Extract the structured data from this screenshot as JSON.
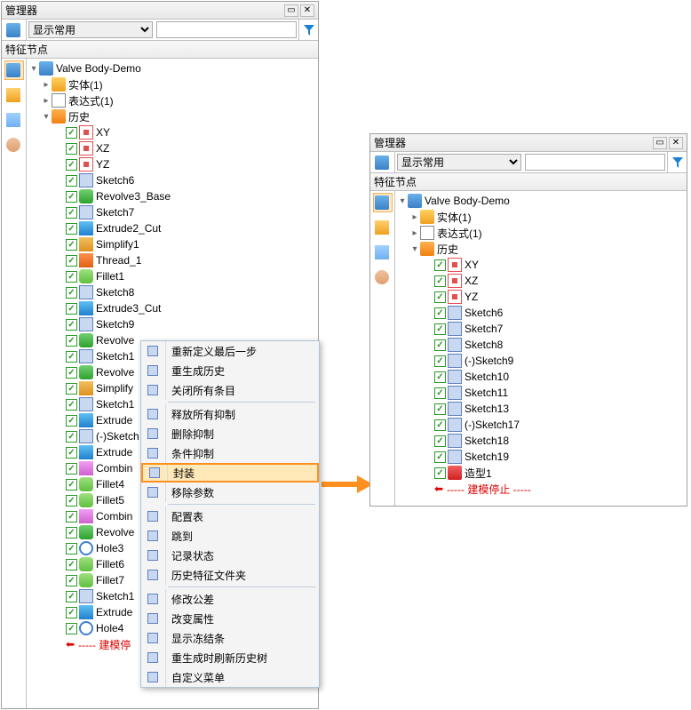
{
  "panels": {
    "left": {
      "title": "管理器",
      "dropdown": "显示常用",
      "search": "",
      "subheader": "特征节点",
      "root": "Valve Body-Demo",
      "top_nodes": {
        "solids": "实体(1)",
        "expr": "表达式(1)",
        "history": "历史"
      },
      "items": [
        {
          "ic": "ic-plane",
          "lbl": "XY"
        },
        {
          "ic": "ic-plane",
          "lbl": "XZ"
        },
        {
          "ic": "ic-plane",
          "lbl": "YZ"
        },
        {
          "ic": "ic-sketch",
          "lbl": "Sketch6"
        },
        {
          "ic": "ic-revolve",
          "lbl": "Revolve3_Base"
        },
        {
          "ic": "ic-sketch",
          "lbl": "Sketch7"
        },
        {
          "ic": "ic-extrude",
          "lbl": "Extrude2_Cut"
        },
        {
          "ic": "ic-simplify",
          "lbl": "Simplify1"
        },
        {
          "ic": "ic-thread",
          "lbl": "Thread_1"
        },
        {
          "ic": "ic-fillet",
          "lbl": "Fillet1"
        },
        {
          "ic": "ic-sketch",
          "lbl": "Sketch8"
        },
        {
          "ic": "ic-extrude",
          "lbl": "Extrude3_Cut"
        },
        {
          "ic": "ic-sketch",
          "lbl": "Sketch9"
        },
        {
          "ic": "ic-revolve",
          "lbl": "Revolve"
        },
        {
          "ic": "ic-sketch",
          "lbl": "Sketch1"
        },
        {
          "ic": "ic-revolve",
          "lbl": "Revolve"
        },
        {
          "ic": "ic-simplify",
          "lbl": "Simplify"
        },
        {
          "ic": "ic-sketch",
          "lbl": "Sketch1"
        },
        {
          "ic": "ic-extrude",
          "lbl": "Extrude"
        },
        {
          "ic": "ic-sketch",
          "lbl": "(-)Sketch"
        },
        {
          "ic": "ic-extrude",
          "lbl": "Extrude"
        },
        {
          "ic": "ic-combine",
          "lbl": "Combin"
        },
        {
          "ic": "ic-fillet",
          "lbl": "Fillet4"
        },
        {
          "ic": "ic-fillet",
          "lbl": "Fillet5"
        },
        {
          "ic": "ic-combine",
          "lbl": "Combin"
        },
        {
          "ic": "ic-revolve",
          "lbl": "Revolve"
        },
        {
          "ic": "ic-hole",
          "lbl": "Hole3"
        },
        {
          "ic": "ic-fillet",
          "lbl": "Fillet6"
        },
        {
          "ic": "ic-fillet",
          "lbl": "Fillet7"
        },
        {
          "ic": "ic-sketch",
          "lbl": "Sketch1"
        },
        {
          "ic": "ic-extrude",
          "lbl": "Extrude"
        },
        {
          "ic": "ic-hole",
          "lbl": "Hole4"
        }
      ],
      "stop": "----- 建模停"
    },
    "right": {
      "title": "管理器",
      "dropdown": "显示常用",
      "subheader": "特征节点",
      "root": "Valve Body-Demo",
      "top_nodes": {
        "solids": "实体(1)",
        "expr": "表达式(1)",
        "history": "历史"
      },
      "items": [
        {
          "ic": "ic-plane",
          "lbl": "XY"
        },
        {
          "ic": "ic-plane",
          "lbl": "XZ"
        },
        {
          "ic": "ic-plane",
          "lbl": "YZ"
        },
        {
          "ic": "ic-sketch",
          "lbl": "Sketch6"
        },
        {
          "ic": "ic-sketch",
          "lbl": "Sketch7"
        },
        {
          "ic": "ic-sketch",
          "lbl": "Sketch8"
        },
        {
          "ic": "ic-sketch",
          "lbl": "(-)Sketch9"
        },
        {
          "ic": "ic-sketch",
          "lbl": "Sketch10"
        },
        {
          "ic": "ic-sketch",
          "lbl": "Sketch11"
        },
        {
          "ic": "ic-sketch",
          "lbl": "Sketch13"
        },
        {
          "ic": "ic-sketch",
          "lbl": "(-)Sketch17"
        },
        {
          "ic": "ic-sketch",
          "lbl": "Sketch18"
        },
        {
          "ic": "ic-sketch",
          "lbl": "Sketch19"
        },
        {
          "ic": "ic-shape",
          "lbl": "造型1"
        }
      ],
      "stop": "----- 建模停止 -----"
    }
  },
  "sidebar_icons": [
    "assembly",
    "cube",
    "image",
    "person"
  ],
  "context_menu": [
    {
      "lbl": "重新定义最后一步",
      "sep": false
    },
    {
      "lbl": "重生成历史",
      "sep": false
    },
    {
      "lbl": "关闭所有条目",
      "sep": true
    },
    {
      "lbl": "释放所有抑制",
      "sep": false
    },
    {
      "lbl": "删除抑制",
      "sep": false
    },
    {
      "lbl": "条件抑制",
      "sep": false
    },
    {
      "lbl": "封装",
      "sep": false,
      "hl": true
    },
    {
      "lbl": "移除参数",
      "sep": true
    },
    {
      "lbl": "配置表",
      "sep": false
    },
    {
      "lbl": "跳到",
      "sep": false
    },
    {
      "lbl": "记录状态",
      "sep": false
    },
    {
      "lbl": "历史特征文件夹",
      "sep": true
    },
    {
      "lbl": "修改公差",
      "sep": false
    },
    {
      "lbl": "改变属性",
      "sep": false
    },
    {
      "lbl": "显示冻结条",
      "sep": false
    },
    {
      "lbl": "重生成时刷新历史树",
      "sep": false
    },
    {
      "lbl": "自定义菜单",
      "sep": false
    }
  ]
}
